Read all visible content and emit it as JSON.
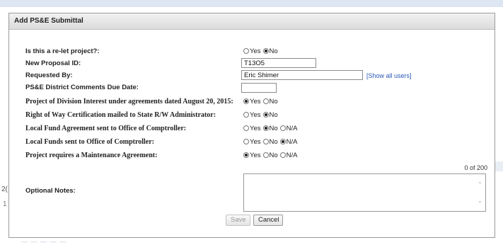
{
  "background": {
    "left_text_1": "2(",
    "left_text_2": "1",
    "bottom_ghost": "— — — — —"
  },
  "dialog": {
    "title": "Add PS&E Submittal"
  },
  "fields": {
    "relet": {
      "label": "Is this a re-let project?:",
      "options": [
        "Yes",
        "No"
      ],
      "selected": "No"
    },
    "proposal_id": {
      "label": "New Proposal ID:",
      "value": "T13O5"
    },
    "requested_by": {
      "label": "Requested By:",
      "value": "Eric Shimer",
      "link": "[Show all users]"
    },
    "comments_due": {
      "label": "PS&E District Comments Due Date:",
      "value": ""
    },
    "division_interest": {
      "label": "Project of Division Interest under agreements dated August 20, 2015:",
      "options": [
        "Yes",
        "No"
      ],
      "selected": "Yes"
    },
    "row_cert": {
      "label": "Right of Way Certification mailed to State R/W Administrator:",
      "options": [
        "Yes",
        "No"
      ],
      "selected": "No"
    },
    "local_fund_agreement": {
      "label": "Local Fund Agreement sent to Office of Comptroller:",
      "options": [
        "Yes",
        "No",
        "N/A"
      ],
      "selected": "No"
    },
    "local_funds": {
      "label": "Local Funds sent to Office of Comptroller:",
      "options": [
        "Yes",
        "No",
        "N/A"
      ],
      "selected": "N/A"
    },
    "maintenance": {
      "label": "Project requires a Maintenance Agreement:",
      "options": [
        "Yes",
        "No",
        "N/A"
      ],
      "selected": "Yes"
    },
    "notes": {
      "label": "Optional Notes:",
      "counter": "0 of 200",
      "value": ""
    }
  },
  "buttons": {
    "save": "Save",
    "cancel": "Cancel"
  }
}
